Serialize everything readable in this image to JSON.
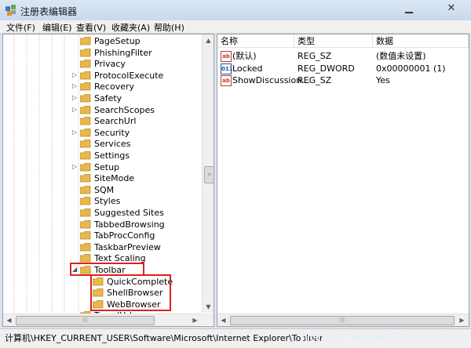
{
  "window": {
    "title": "注册表编辑器",
    "minimize": "▁",
    "close": "✕"
  },
  "menu": [
    "文件(F)",
    "编辑(E)",
    "查看(V)",
    "收藏夹(A)",
    "帮助(H)"
  ],
  "tree": {
    "items": [
      {
        "label": "PageSetup",
        "expander": ""
      },
      {
        "label": "PhishingFilter",
        "expander": ""
      },
      {
        "label": "Privacy",
        "expander": ""
      },
      {
        "label": "ProtocolExecute",
        "expander": "▷"
      },
      {
        "label": "Recovery",
        "expander": "▷"
      },
      {
        "label": "Safety",
        "expander": "▷"
      },
      {
        "label": "SearchScopes",
        "expander": "▷"
      },
      {
        "label": "SearchUrl",
        "expander": ""
      },
      {
        "label": "Security",
        "expander": "▷"
      },
      {
        "label": "Services",
        "expander": ""
      },
      {
        "label": "Settings",
        "expander": ""
      },
      {
        "label": "Setup",
        "expander": "▷"
      },
      {
        "label": "SiteMode",
        "expander": ""
      },
      {
        "label": "SQM",
        "expander": ""
      },
      {
        "label": "Styles",
        "expander": ""
      },
      {
        "label": "Suggested Sites",
        "expander": ""
      },
      {
        "label": "TabbedBrowsing",
        "expander": ""
      },
      {
        "label": "TabProcConfig",
        "expander": ""
      },
      {
        "label": "TaskbarPreview",
        "expander": ""
      },
      {
        "label": "Text Scaling",
        "expander": ""
      },
      {
        "label": "Toolbar",
        "expander": "◢"
      },
      {
        "label": "QuickComplete",
        "expander": "",
        "child": true
      },
      {
        "label": "ShellBrowser",
        "expander": "",
        "child": true
      },
      {
        "label": "WebBrowser",
        "expander": "",
        "child": true
      },
      {
        "label": "TypedUrls",
        "expander": ""
      }
    ],
    "scroll_glyphs": {
      "up": "▲",
      "down": "▼",
      "left": "◀",
      "right": "▶",
      "grip_v": "≡",
      "grip_h": "|||"
    }
  },
  "values": {
    "headers": [
      "名称",
      "类型",
      "数据"
    ],
    "rows": [
      {
        "icon": "ab",
        "name": "(默认)",
        "type": "REG_SZ",
        "data": "(数值未设置)",
        "color": "#c0392b"
      },
      {
        "icon": "011",
        "name": "Locked",
        "type": "REG_DWORD",
        "data": "0x00000001 (1)",
        "color": "#1f4fa8"
      },
      {
        "icon": "ab",
        "name": "ShowDiscussion...",
        "type": "REG_SZ",
        "data": "Yes",
        "color": "#c0392b"
      }
    ]
  },
  "status": {
    "path": "计算机\\HKEY_CURRENT_USER\\Software\\Microsoft\\Internet Explorer\\Toolbar",
    "watermark": "https://www.f7admin.cc"
  },
  "colors": {
    "highlight_box": "#e02020",
    "folder": "#e8b84a"
  }
}
